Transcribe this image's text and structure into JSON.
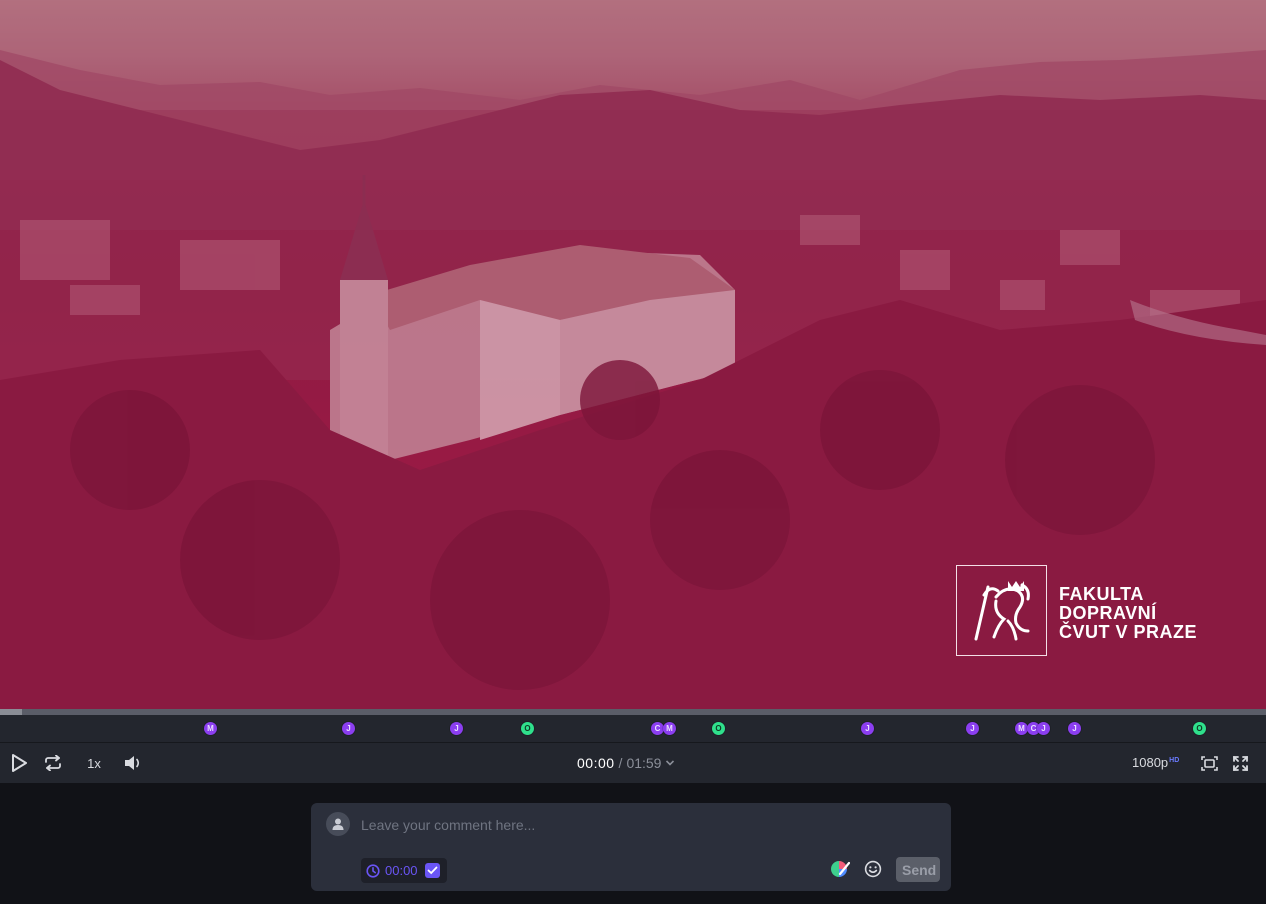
{
  "video": {
    "overlay_color": "#9a1a45",
    "logo": {
      "icon": "lion-crest-icon",
      "lines": [
        "FAKULTA",
        "DOPRAVNÍ",
        "ČVUT V PRAZE"
      ]
    }
  },
  "progress": {
    "played_fraction": 0.017
  },
  "markers": [
    {
      "letter": "M",
      "color": "purple"
    },
    {
      "letter": "J",
      "color": "purple"
    },
    {
      "letter": "J",
      "color": "purple"
    },
    {
      "letter": "O",
      "color": "green"
    },
    {
      "letter": "C",
      "color": "purple"
    },
    {
      "letter": "M",
      "color": "purple"
    },
    {
      "letter": "O",
      "color": "green"
    },
    {
      "letter": "J",
      "color": "purple"
    },
    {
      "letter": "J",
      "color": "purple"
    },
    {
      "letter": "M",
      "color": "purple"
    },
    {
      "letter": "C",
      "color": "purple"
    },
    {
      "letter": "J",
      "color": "purple"
    },
    {
      "letter": "J",
      "color": "purple"
    },
    {
      "letter": "O",
      "color": "green"
    }
  ],
  "controls": {
    "play_icon": "play-icon",
    "loop_icon": "loop-icon",
    "speed": "1x",
    "volume_icon": "volume-icon",
    "current_time": "00:00",
    "separator": "/",
    "duration": "01:59",
    "quality": "1080p",
    "quality_badge": "HD",
    "frame_icon": "frame-icon",
    "fullscreen_icon": "fullscreen-icon"
  },
  "comment": {
    "placeholder": "Leave your comment here...",
    "timestamp": "00:00",
    "timestamp_checked": true,
    "send_label": "Send"
  },
  "colors": {
    "accent": "#6a55f5",
    "marker_purple": "#8b3ef0",
    "marker_green": "#2fe08c",
    "controls_bg": "#23262e",
    "page_bg": "#111217"
  }
}
